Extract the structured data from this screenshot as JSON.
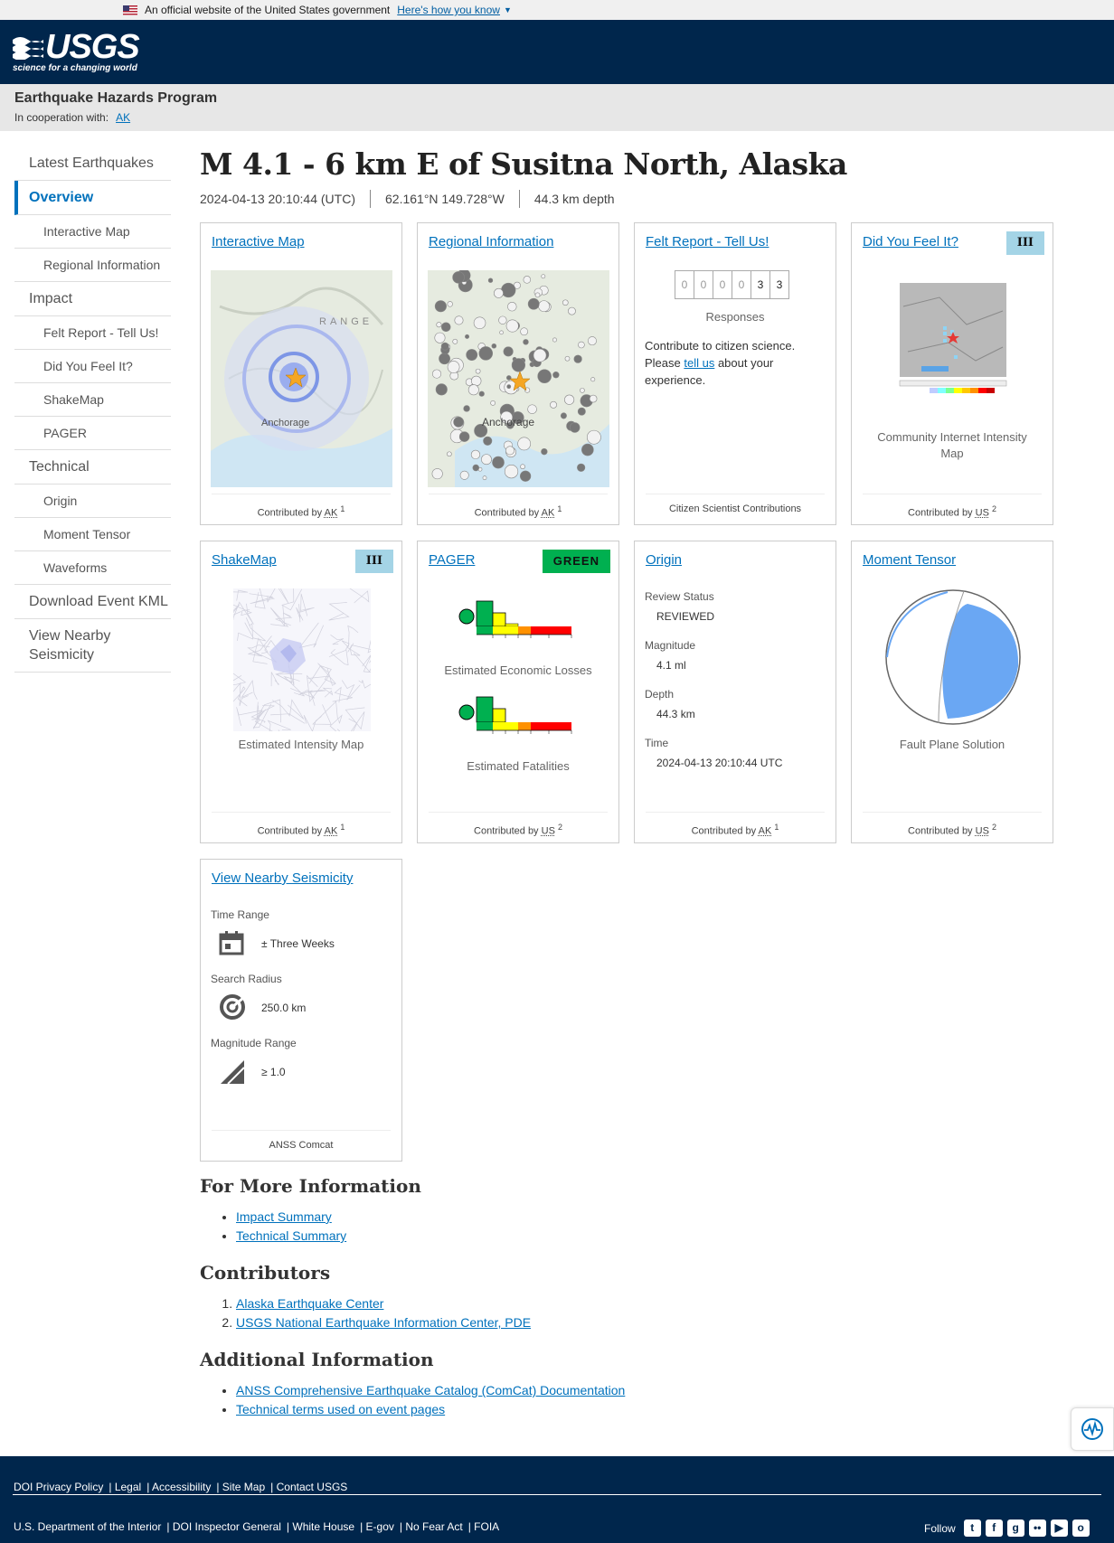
{
  "gov_banner": {
    "text": "An official website of the United States government",
    "link": "Here's how you know"
  },
  "header": {
    "logo": "USGS",
    "tagline": "science for a changing world"
  },
  "site": {
    "name": "Earthquake Hazards Program",
    "coop_label": "In cooperation with:",
    "coop_link": "AK"
  },
  "nav": [
    {
      "label": "Latest Earthquakes",
      "level": 0
    },
    {
      "label": "Overview",
      "level": 0,
      "active": true
    },
    {
      "label": "Interactive Map",
      "level": 1
    },
    {
      "label": "Regional Information",
      "level": 1
    },
    {
      "label": "Impact",
      "level": 0
    },
    {
      "label": "Felt Report - Tell Us!",
      "level": 1
    },
    {
      "label": "Did You Feel It?",
      "level": 1
    },
    {
      "label": "ShakeMap",
      "level": 1
    },
    {
      "label": "PAGER",
      "level": 1
    },
    {
      "label": "Technical",
      "level": 0
    },
    {
      "label": "Origin",
      "level": 1
    },
    {
      "label": "Moment Tensor",
      "level": 1
    },
    {
      "label": "Waveforms",
      "level": 1
    },
    {
      "label": "Download Event KML",
      "level": 0
    },
    {
      "label": "View Nearby Seismicity",
      "level": 0
    }
  ],
  "event": {
    "title": "M 4.1 - 6 km E of Susitna North, Alaska",
    "time": "2024-04-13 20:10:44 (UTC)",
    "location": "62.161°N 149.728°W",
    "depth": "44.3 km depth"
  },
  "cards": {
    "interactive_map": {
      "title": "Interactive Map",
      "contrib": "Contributed by",
      "net": "AK",
      "ref": "1",
      "place": "Anchorage",
      "range": "RANGE"
    },
    "regional": {
      "title": "Regional Information",
      "contrib": "Contributed by",
      "net": "AK",
      "ref": "1",
      "place": "Anchorage"
    },
    "felt": {
      "title": "Felt Report - Tell Us!",
      "digits": [
        "0",
        "0",
        "0",
        "0",
        "3",
        "3"
      ],
      "responses": "Responses",
      "text1": "Contribute to citizen science. Please ",
      "link": "tell us",
      "text2": " about your experience.",
      "foot": "Citizen Scientist Contributions"
    },
    "dyfi": {
      "title": "Did You Feel It?",
      "badge": "III",
      "caption": "Community Internet Intensity Map",
      "contrib": "Contributed by",
      "net": "US",
      "ref": "2"
    },
    "shakemap": {
      "title": "ShakeMap",
      "badge": "III",
      "caption": "Estimated Intensity Map",
      "contrib": "Contributed by",
      "net": "AK",
      "ref": "1"
    },
    "pager": {
      "title": "PAGER",
      "badge": "GREEN",
      "caption1": "Estimated Economic Losses",
      "caption2": "Estimated Fatalities",
      "contrib": "Contributed by",
      "net": "US",
      "ref": "2"
    },
    "origin": {
      "title": "Origin",
      "fields": [
        {
          "label": "Review Status",
          "value": "REVIEWED"
        },
        {
          "label": "Magnitude",
          "value": "4.1 ml"
        },
        {
          "label": "Depth",
          "value": "44.3 km"
        },
        {
          "label": "Time",
          "value": "2024-04-13 20:10:44 UTC"
        }
      ],
      "contrib": "Contributed by",
      "net": "AK",
      "ref": "1"
    },
    "moment": {
      "title": "Moment Tensor",
      "caption": "Fault Plane Solution",
      "contrib": "Contributed by",
      "net": "US",
      "ref": "2"
    },
    "nearby": {
      "title": "View Nearby Seismicity",
      "time_label": "Time Range",
      "time_value": "± Three Weeks",
      "radius_label": "Search Radius",
      "radius_value": "250.0 km",
      "mag_label": "Magnitude Range",
      "mag_value": "≥ 1.0",
      "foot": "ANSS Comcat"
    }
  },
  "more_info": {
    "heading": "For More Information",
    "links": [
      "Impact Summary",
      "Technical Summary"
    ]
  },
  "contributors": {
    "heading": "Contributors",
    "links": [
      "Alaska Earthquake Center",
      "USGS National Earthquake Information Center, PDE"
    ]
  },
  "additional": {
    "heading": "Additional Information",
    "links": [
      "ANSS Comprehensive Earthquake Catalog (ComCat) Documentation",
      "Technical terms used on event pages"
    ]
  },
  "footer": {
    "row1": [
      "DOI Privacy Policy",
      "Legal",
      "Accessibility",
      "Site Map",
      "Contact USGS"
    ],
    "row2": [
      "U.S. Department of the Interior",
      "DOI Inspector General",
      "White House",
      "E-gov",
      "No Fear Act",
      "FOIA"
    ],
    "follow": "Follow"
  },
  "colors": {
    "usgs_navy": "#00264c",
    "link": "#0071bc",
    "pager_green": "#00b050",
    "intensity_iii": "#a4d4e6"
  }
}
